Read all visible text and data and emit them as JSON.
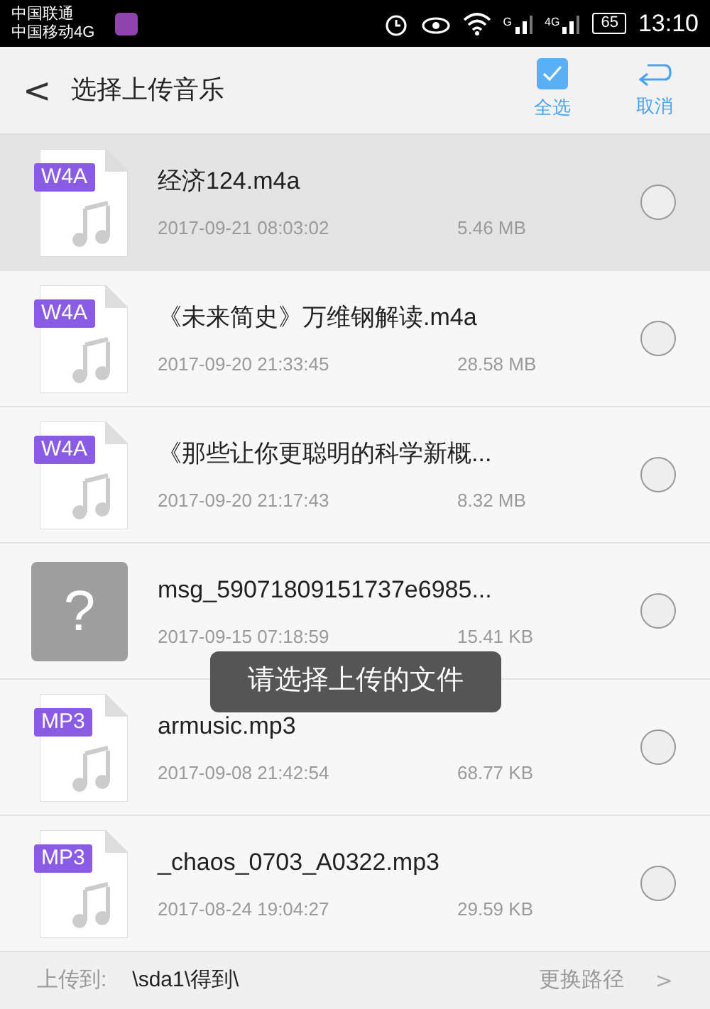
{
  "status_bar": {
    "carriers": [
      "中国联通",
      "中国移动4G"
    ],
    "signal_labels": [
      "G",
      "4G"
    ],
    "battery": "65",
    "time": "13:10"
  },
  "header": {
    "back": "<",
    "title": "选择上传音乐",
    "select_all": {
      "label": "全选",
      "checked": true
    },
    "cancel": "取消"
  },
  "files": [
    {
      "kind": "audio",
      "badge": "W4A",
      "name": "经济124.m4a",
      "date": "2017-09-21 08:03:02",
      "size": "5.46 MB",
      "pressed": true,
      "selected": false
    },
    {
      "kind": "audio",
      "badge": "W4A",
      "name": "《未来简史》万维钢解读.m4a",
      "date": "2017-09-20 21:33:45",
      "size": "28.58 MB",
      "pressed": false,
      "selected": false
    },
    {
      "kind": "audio",
      "badge": "W4A",
      "name": "《那些让你更聪明的科学新概...",
      "date": "2017-09-20 21:17:43",
      "size": "8.32 MB",
      "pressed": false,
      "selected": false
    },
    {
      "kind": "unknown",
      "badge": "?",
      "name": "msg_59071809151737e6985...",
      "date": "2017-09-15 07:18:59",
      "size": "15.41 KB",
      "pressed": false,
      "selected": false
    },
    {
      "kind": "audio",
      "badge": "MP3",
      "name": "armusic.mp3",
      "date": "2017-09-08 21:42:54",
      "size": "68.77 KB",
      "pressed": false,
      "selected": false
    },
    {
      "kind": "audio",
      "badge": "MP3",
      "name": "_chaos_0703_A0322.mp3",
      "date": "2017-08-24 19:04:27",
      "size": "29.59 KB",
      "pressed": false,
      "selected": false
    }
  ],
  "toast": "请选择上传的文件",
  "footer": {
    "label": "上传到:",
    "path": "\\sda1\\得到\\",
    "change": "更换路径",
    "chevron": ">"
  }
}
